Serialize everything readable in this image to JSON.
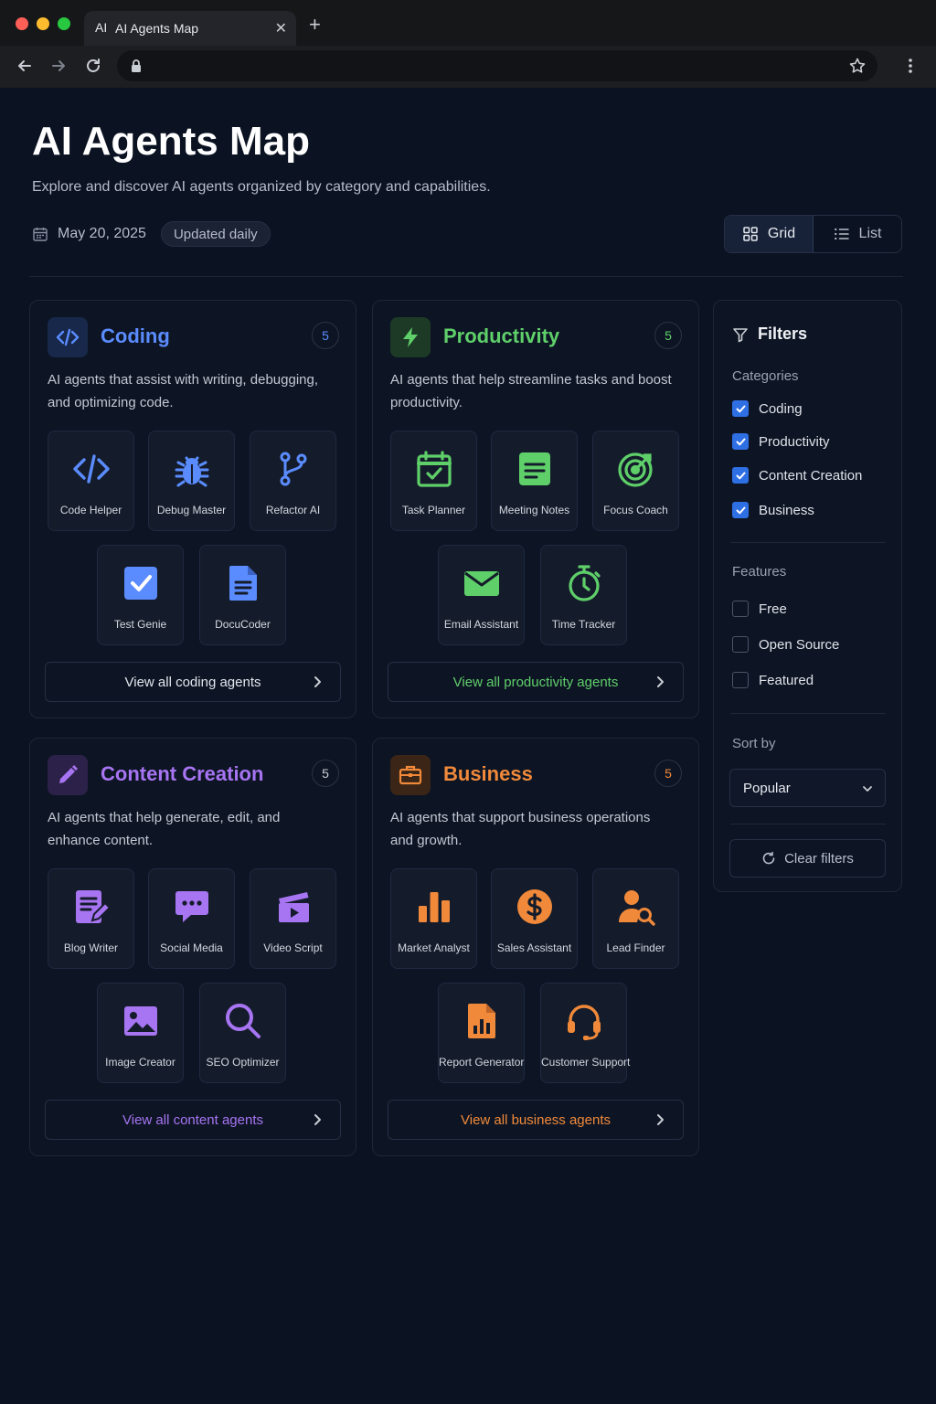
{
  "browser": {
    "tab_title": "AI Agents Map",
    "tab_favicon": "AI",
    "traffic_colors": [
      "#fe5f57",
      "#febc2e",
      "#28c840"
    ]
  },
  "header": {
    "title": "AI Agents Map",
    "subtitle": "Explore and discover AI agents organized by category and capabilities.",
    "date": "May 20, 2025",
    "badge": "Updated daily",
    "view_grid": "Grid",
    "view_list": "List"
  },
  "categories": [
    {
      "title": "Coding",
      "count": "5",
      "desc": "AI agents that assist with writing, debugging, and optimizing code.",
      "color": "#5b8cff",
      "view_all": "View all coding agents",
      "agents": [
        {
          "name": "Code Helper",
          "icon": "code-icon"
        },
        {
          "name": "Debug Master",
          "icon": "bug-icon"
        },
        {
          "name": "Refactor AI",
          "icon": "git-branch-icon"
        },
        {
          "name": "Test Genie",
          "icon": "checkbox-icon"
        },
        {
          "name": "DocuCoder",
          "icon": "document-icon"
        }
      ]
    },
    {
      "title": "Productivity",
      "count": "5",
      "desc": "AI agents that help streamline tasks and boost productivity.",
      "color": "#5fcf6a",
      "view_all": "View all productivity agents",
      "agents": [
        {
          "name": "Task Planner",
          "icon": "calendar-check-icon"
        },
        {
          "name": "Meeting Notes",
          "icon": "note-icon"
        },
        {
          "name": "Focus Coach",
          "icon": "target-icon"
        },
        {
          "name": "Email Assistant",
          "icon": "envelope-icon"
        },
        {
          "name": "Time Tracker",
          "icon": "stopwatch-icon"
        }
      ]
    },
    {
      "title": "Content Creation",
      "count": "5",
      "desc": "AI agents that help generate, edit, and enhance content.",
      "color": "#a774f2",
      "view_all": "View all content agents",
      "agents": [
        {
          "name": "Blog Writer",
          "icon": "edit-document-icon"
        },
        {
          "name": "Social Media",
          "icon": "chat-bubble-icon"
        },
        {
          "name": "Video Script",
          "icon": "clapperboard-icon"
        },
        {
          "name": "Image Creator",
          "icon": "image-icon"
        },
        {
          "name": "SEO Optimizer",
          "icon": "magnifier-icon"
        }
      ]
    },
    {
      "title": "Business",
      "count": "5",
      "desc": "AI agents that support business operations and growth.",
      "color": "#f0893a",
      "view_all": "View all business agents",
      "agents": [
        {
          "name": "Market Analyst",
          "icon": "bar-chart-icon"
        },
        {
          "name": "Sales Assistant",
          "icon": "dollar-icon"
        },
        {
          "name": "Lead Finder",
          "icon": "user-search-icon"
        },
        {
          "name": "Report Generator",
          "icon": "report-icon"
        },
        {
          "name": "Customer Support",
          "icon": "headset-icon"
        }
      ]
    }
  ],
  "filters": {
    "title": "Filters",
    "categories_label": "Categories",
    "categories": [
      {
        "label": "Coding",
        "checked": true
      },
      {
        "label": "Productivity",
        "checked": true
      },
      {
        "label": "Content Creation",
        "checked": true
      },
      {
        "label": "Business",
        "checked": true
      }
    ],
    "features_label": "Features",
    "features": [
      {
        "label": "Free",
        "checked": false
      },
      {
        "label": "Open Source",
        "checked": false
      },
      {
        "label": "Featured",
        "checked": false
      }
    ],
    "sort_label": "Sort by",
    "sort_value": "Popular",
    "clear_label": "Clear filters"
  }
}
